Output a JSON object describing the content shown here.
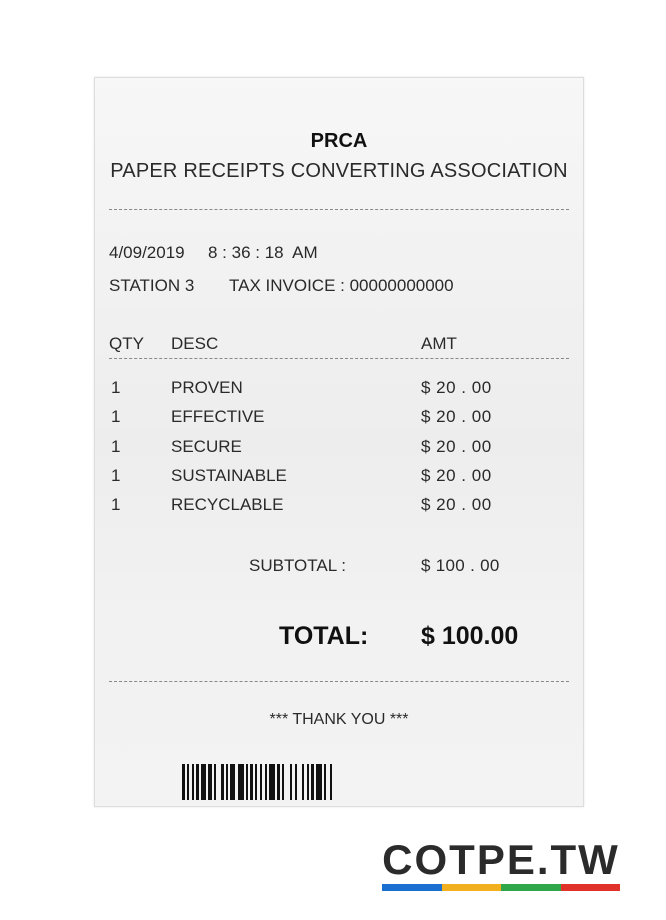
{
  "header": {
    "org_short": "PRCA",
    "org_long": "PAPER RECEIPTS CONVERTING ASSOCIATION"
  },
  "meta": {
    "date": "4/09/2019",
    "time": "8 : 36 : 18  AM",
    "station": "STATION 3",
    "tax_invoice": "TAX INVOICE : 00000000000"
  },
  "table": {
    "columns": [
      "QTY",
      "DESC",
      "AMT"
    ],
    "rows": [
      {
        "qty": "1",
        "desc": "PROVEN",
        "amt": "$ 20 . 00"
      },
      {
        "qty": "1",
        "desc": "EFFECTIVE",
        "amt": "$ 20 . 00"
      },
      {
        "qty": "1",
        "desc": "SECURE",
        "amt": "$ 20 . 00"
      },
      {
        "qty": "1",
        "desc": "SUSTAINABLE",
        "amt": "$ 20 . 00"
      },
      {
        "qty": "1",
        "desc": "RECYCLABLE",
        "amt": "$ 20 . 00"
      }
    ]
  },
  "totals": {
    "subtotal_label": "SUBTOTAL :",
    "subtotal_value": "$ 100 . 00",
    "total_label": "TOTAL:",
    "total_value": "$ 100.00"
  },
  "footer": {
    "thanks": "*** THANK YOU ***",
    "barcode_icon": "barcode-icon"
  },
  "watermark": {
    "text": "COTPE.TW",
    "bar_colors": [
      "#1a6fd0",
      "#f2b01e",
      "#2fa64a",
      "#e0322a"
    ]
  }
}
